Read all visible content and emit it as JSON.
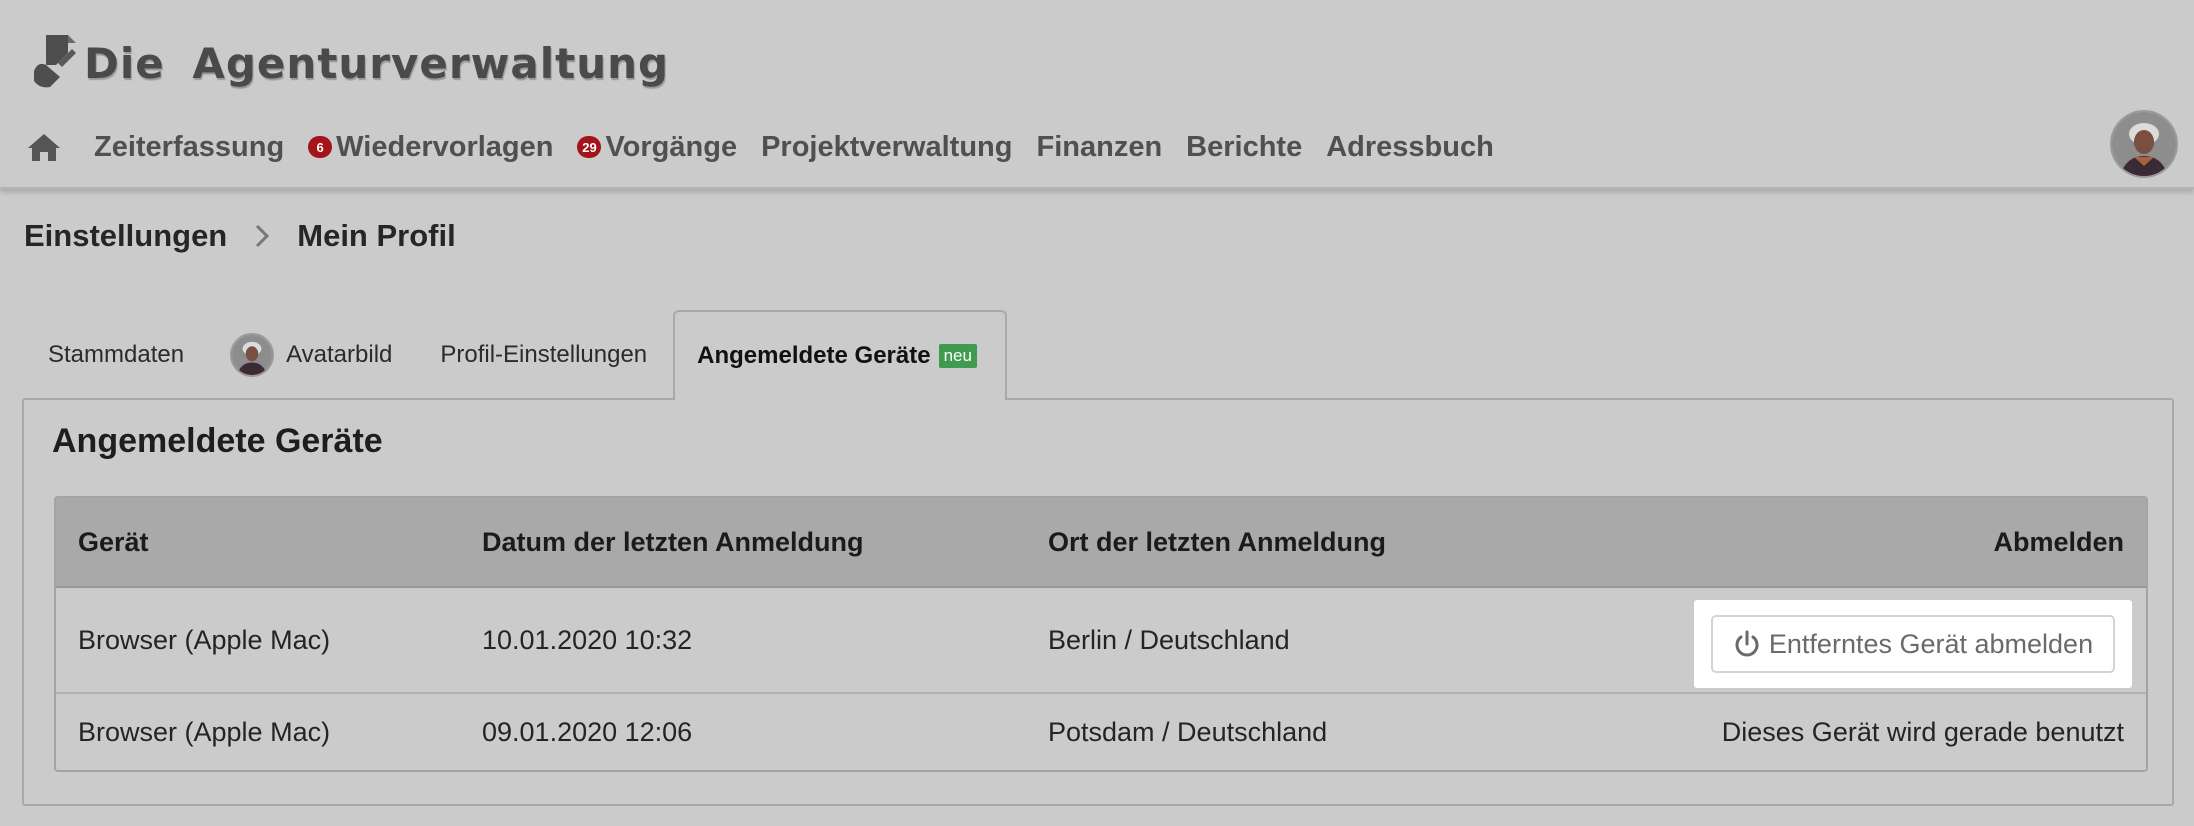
{
  "app": {
    "logo_text": "Die Agenturverwaltung"
  },
  "nav": {
    "home_icon": "home-icon",
    "items": [
      {
        "label": "Zeiterfassung"
      },
      {
        "label": "Wiedervorlagen",
        "badge": "6"
      },
      {
        "label": "Vorgänge",
        "badge": "29"
      },
      {
        "label": "Projektverwaltung"
      },
      {
        "label": "Finanzen"
      },
      {
        "label": "Berichte"
      },
      {
        "label": "Adressbuch"
      }
    ]
  },
  "breadcrumb": {
    "items": [
      "Einstellungen",
      "Mein Profil"
    ]
  },
  "tabs": {
    "items": [
      {
        "label": "Stammdaten"
      },
      {
        "label": "Avatarbild"
      },
      {
        "label": "Profil-Einstellungen"
      },
      {
        "label": "Angemeldete Geräte",
        "tag": "neu",
        "active": true
      }
    ]
  },
  "panel": {
    "title": "Angemeldete Geräte"
  },
  "table": {
    "headers": [
      "Gerät",
      "Datum der letzten Anmeldung",
      "Ort der letzten Anmeldung",
      "Abmelden"
    ],
    "rows": [
      {
        "device": "Browser (Apple Mac)",
        "date": "10.01.2020 10:32",
        "location": "Berlin / Deutschland",
        "action": "Entferntes Gerät abmelden"
      },
      {
        "device": "Browser (Apple Mac)",
        "date": "09.01.2020 12:06",
        "location": "Potsdam / Deutschland",
        "action": "Dieses Gerät wird gerade benutzt"
      }
    ]
  },
  "colors": {
    "background": "#cbcbcb",
    "table_header": "#a9a9a9",
    "badge": "#a3151b",
    "tag_new": "#3f9b4f"
  }
}
